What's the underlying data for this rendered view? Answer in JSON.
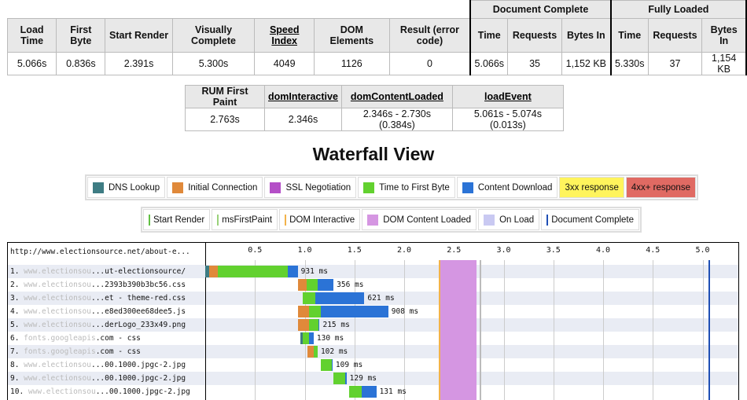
{
  "results": {
    "headers": [
      "Load Time",
      "First Byte",
      "Start Render",
      "Visually Complete",
      "Speed Index",
      "DOM Elements",
      "Result (error code)"
    ],
    "group_doc": "Document Complete",
    "group_full": "Fully Loaded",
    "sub_headers": [
      "Time",
      "Requests",
      "Bytes In"
    ],
    "values": [
      "5.066s",
      "0.836s",
      "2.391s",
      "5.300s",
      "4049",
      "1126",
      "0"
    ],
    "doc_values": [
      "5.066s",
      "35",
      "1,152 KB"
    ],
    "full_values": [
      "5.330s",
      "37",
      "1,154 KB"
    ]
  },
  "rum": {
    "headers": [
      "RUM First Paint",
      "domInteractive",
      "domContentLoaded",
      "loadEvent"
    ],
    "values": [
      "2.763s",
      "2.346s",
      "2.346s - 2.730s (0.384s)",
      "5.061s - 5.074s (0.013s)"
    ]
  },
  "waterfall_title": "Waterfall View",
  "legend1": [
    {
      "label": "DNS Lookup",
      "color": "#3e7c83"
    },
    {
      "label": "Initial Connection",
      "color": "#e0893a"
    },
    {
      "label": "SSL Negotiation",
      "color": "#b44fc7"
    },
    {
      "label": "Time to First Byte",
      "color": "#62d12f"
    },
    {
      "label": "Content Download",
      "color": "#2b73d6"
    },
    {
      "label": "3xx response",
      "color": "#fff45c",
      "badge": true
    },
    {
      "label": "4xx+ response",
      "color": "#e06a63",
      "badge": true
    }
  ],
  "legend2": [
    {
      "label": "Start Render",
      "color": "#62c044",
      "type": "line"
    },
    {
      "label": "msFirstPaint",
      "color": "#9ad17a",
      "type": "line"
    },
    {
      "label": "DOM Interactive",
      "color": "#f2b24a",
      "type": "line"
    },
    {
      "label": "DOM Content Loaded",
      "color": "#d596e2",
      "type": "box"
    },
    {
      "label": "On Load",
      "color": "#c9c9f2",
      "type": "box"
    },
    {
      "label": "Document Complete",
      "color": "#1f4fb5",
      "type": "line"
    }
  ],
  "waterfall": {
    "url": "http://www.electionsource.net/about-e...",
    "ticks": [
      "0.5",
      "1.0",
      "1.5",
      "2.0",
      "2.5",
      "3.0",
      "3.5",
      "4.0",
      "4.5",
      "5.0"
    ],
    "rows": [
      {
        "num": "1.",
        "host": "www.electionsou",
        "path": "...ut-electionsource/",
        "ms": "931 ms"
      },
      {
        "num": "2.",
        "host": "www.electionsou",
        "path": "...2393b390b3bc56.css",
        "ms": "356 ms"
      },
      {
        "num": "3.",
        "host": "www.electionsou",
        "path": "...et - theme-red.css",
        "ms": "621 ms"
      },
      {
        "num": "4.",
        "host": "www.electionsou",
        "path": "...e8ed300ee68dee5.js",
        "ms": "908 ms"
      },
      {
        "num": "5.",
        "host": "www.electionsou",
        "path": "...derLogo_233x49.png",
        "ms": "215 ms"
      },
      {
        "num": "6.",
        "host": "fonts.googleapis",
        "path": ".com - css",
        "ms": "130 ms"
      },
      {
        "num": "7.",
        "host": "fonts.googleapis",
        "path": ".com - css",
        "ms": "102 ms"
      },
      {
        "num": "8.",
        "host": "www.electionsou",
        "path": "...00.1000.jpgc-2.jpg",
        "ms": "109 ms"
      },
      {
        "num": "9.",
        "host": "www.electionsou",
        "path": "...00.1000.jpgc-2.jpg",
        "ms": "129 ms"
      },
      {
        "num": "10.",
        "host": "www.electionsou",
        "path": "...00.1000.jpgc-2.jpg",
        "ms": "131 ms"
      }
    ]
  }
}
